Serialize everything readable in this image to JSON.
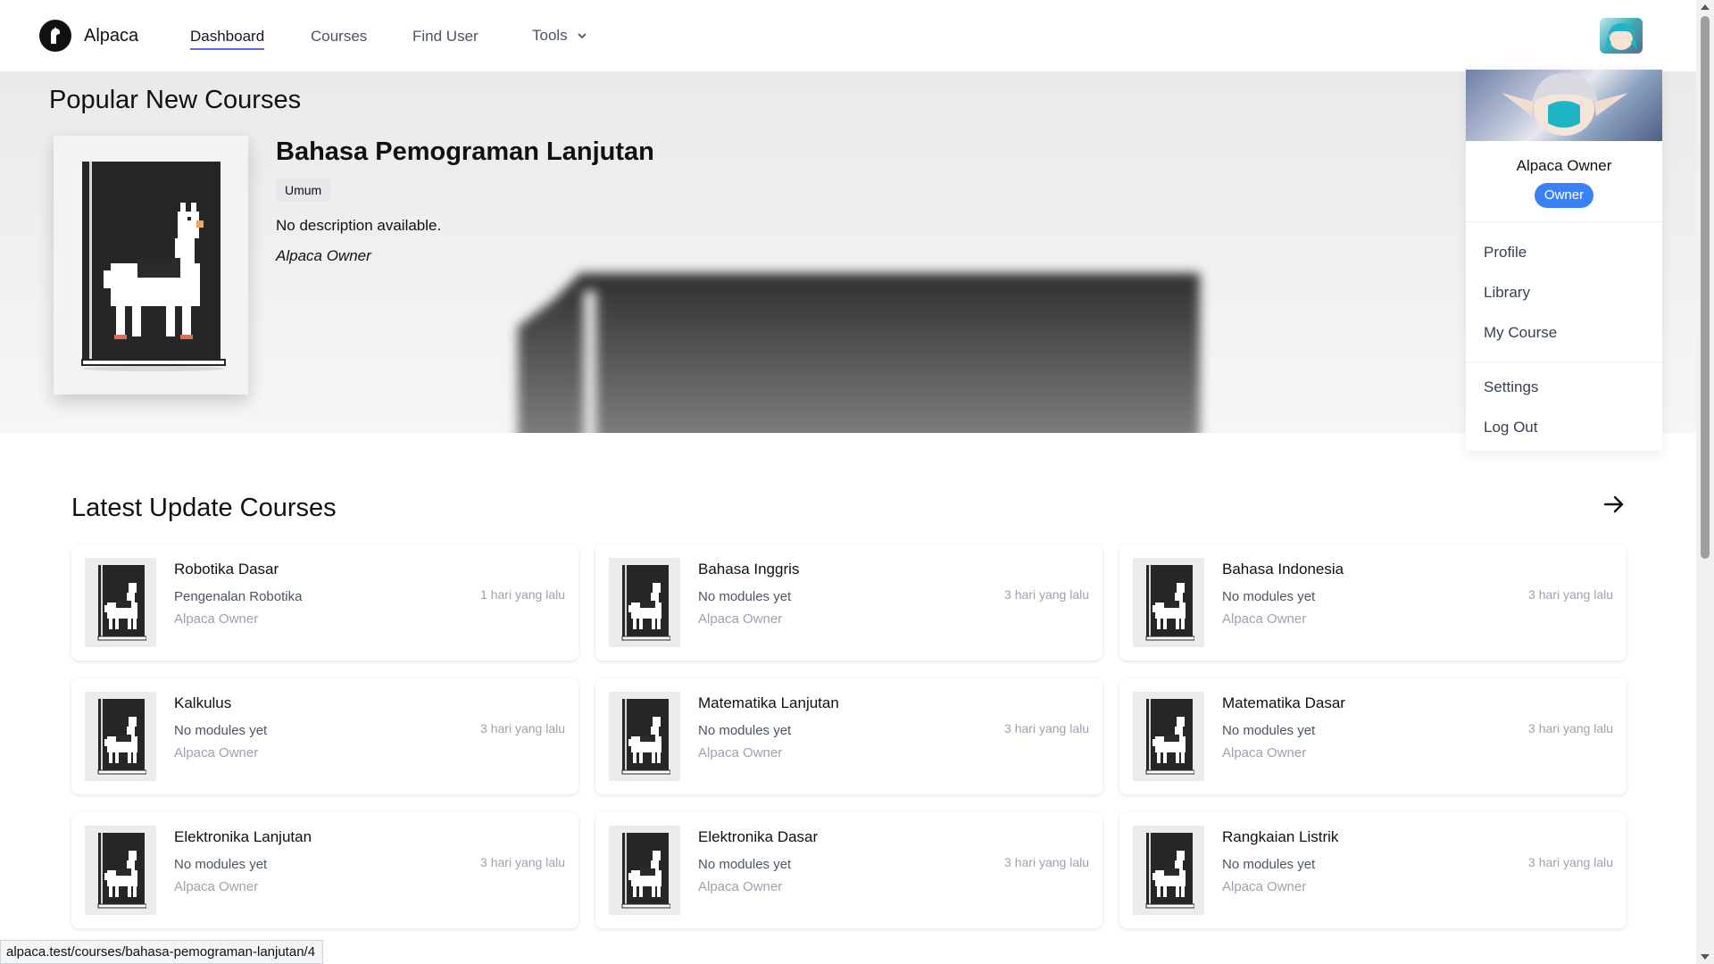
{
  "app": {
    "name": "Alpaca"
  },
  "nav": {
    "links": [
      {
        "label": "Dashboard",
        "active": true
      },
      {
        "label": "Courses"
      },
      {
        "label": "Find User"
      },
      {
        "label": "Tools"
      }
    ]
  },
  "hero": {
    "heading": "Popular New Courses",
    "course": {
      "title": "Bahasa Pemograman Lanjutan",
      "tag": "Umum",
      "description": "No description available.",
      "author": "Alpaca Owner"
    }
  },
  "dropdown": {
    "user_name": "Alpaca Owner",
    "role_badge": "Owner",
    "items": [
      "Profile",
      "Library",
      "My Course",
      "Settings",
      "Log Out"
    ]
  },
  "latest": {
    "heading": "Latest Update Courses",
    "courses": [
      {
        "title": "Robotika Dasar",
        "subtitle": "Pengenalan Robotika",
        "author": "Alpaca Owner",
        "time": "1 hari yang lalu"
      },
      {
        "title": "Bahasa Inggris",
        "subtitle": "No modules yet",
        "author": "Alpaca Owner",
        "time": "3 hari yang lalu"
      },
      {
        "title": "Bahasa Indonesia",
        "subtitle": "No modules yet",
        "author": "Alpaca Owner",
        "time": "3 hari yang lalu"
      },
      {
        "title": "Kalkulus",
        "subtitle": "No modules yet",
        "author": "Alpaca Owner",
        "time": "3 hari yang lalu"
      },
      {
        "title": "Matematika Lanjutan",
        "subtitle": "No modules yet",
        "author": "Alpaca Owner",
        "time": "3 hari yang lalu"
      },
      {
        "title": "Matematika Dasar",
        "subtitle": "No modules yet",
        "author": "Alpaca Owner",
        "time": "3 hari yang lalu"
      },
      {
        "title": "Elektronika Lanjutan",
        "subtitle": "No modules yet",
        "author": "Alpaca Owner",
        "time": "3 hari yang lalu"
      },
      {
        "title": "Elektronika Dasar",
        "subtitle": "No modules yet",
        "author": "Alpaca Owner",
        "time": "3 hari yang lalu"
      },
      {
        "title": "Rangkaian Listrik",
        "subtitle": "No modules yet",
        "author": "Alpaca Owner",
        "time": "3 hari yang lalu"
      }
    ]
  },
  "status_bar": {
    "url": "alpaca.test/courses/bahasa-pemograman-lanjutan/4"
  },
  "icons": {
    "brand": "alpaca-logo-icon",
    "tools_dropdown": "chevron-down-icon",
    "see_more": "arrow-right-icon",
    "course_cover": "book-alpaca-icon"
  },
  "colors": {
    "accent": "#6366f1",
    "badge": "#3b82f6",
    "hero_bg": "#eaeaea"
  }
}
